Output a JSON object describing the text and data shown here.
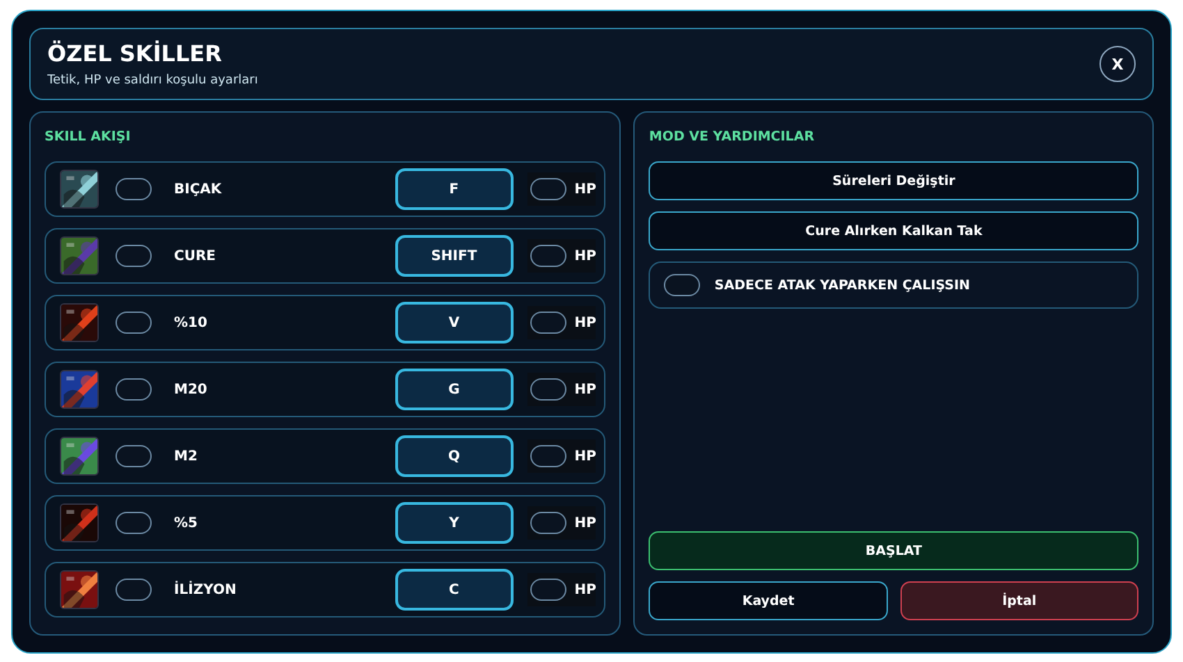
{
  "window": {
    "title": "ÖZEL SKİLLER",
    "subtitle": "Tetik, HP ve saldırı koşulu ayarları",
    "close": "X"
  },
  "skill_flow": {
    "title": "SKILL AKIŞI",
    "rows": [
      {
        "name": "BIÇAK",
        "enabled": false,
        "key": "F",
        "hp_enabled": false,
        "hp_label": "HP"
      },
      {
        "name": "CURE",
        "enabled": false,
        "key": "SHIFT",
        "hp_enabled": false,
        "hp_label": "HP"
      },
      {
        "name": "%10",
        "enabled": false,
        "key": "V",
        "hp_enabled": false,
        "hp_label": "HP"
      },
      {
        "name": "M20",
        "enabled": false,
        "key": "G",
        "hp_enabled": false,
        "hp_label": "HP"
      },
      {
        "name": "M2",
        "enabled": false,
        "key": "Q",
        "hp_enabled": false,
        "hp_label": "HP"
      },
      {
        "name": "%5",
        "enabled": false,
        "key": "Y",
        "hp_enabled": false,
        "hp_label": "HP"
      },
      {
        "name": "İLİZYON",
        "enabled": false,
        "key": "C",
        "hp_enabled": false,
        "hp_label": "HP"
      }
    ]
  },
  "mods": {
    "title": "MOD VE YARDIMCILAR",
    "buttons": [
      "Süreleri Değiştir",
      "Cure Alırken Kalkan Tak"
    ],
    "option": {
      "label": "SADECE ATAK YAPARKEN ÇALIŞSIN",
      "checked": false
    }
  },
  "actions": [
    {
      "label": "BAŞLAT",
      "kind": "start"
    },
    {
      "label": "Kaydet",
      "kind": "save"
    },
    {
      "label": "İptal",
      "kind": "cancel"
    }
  ]
}
